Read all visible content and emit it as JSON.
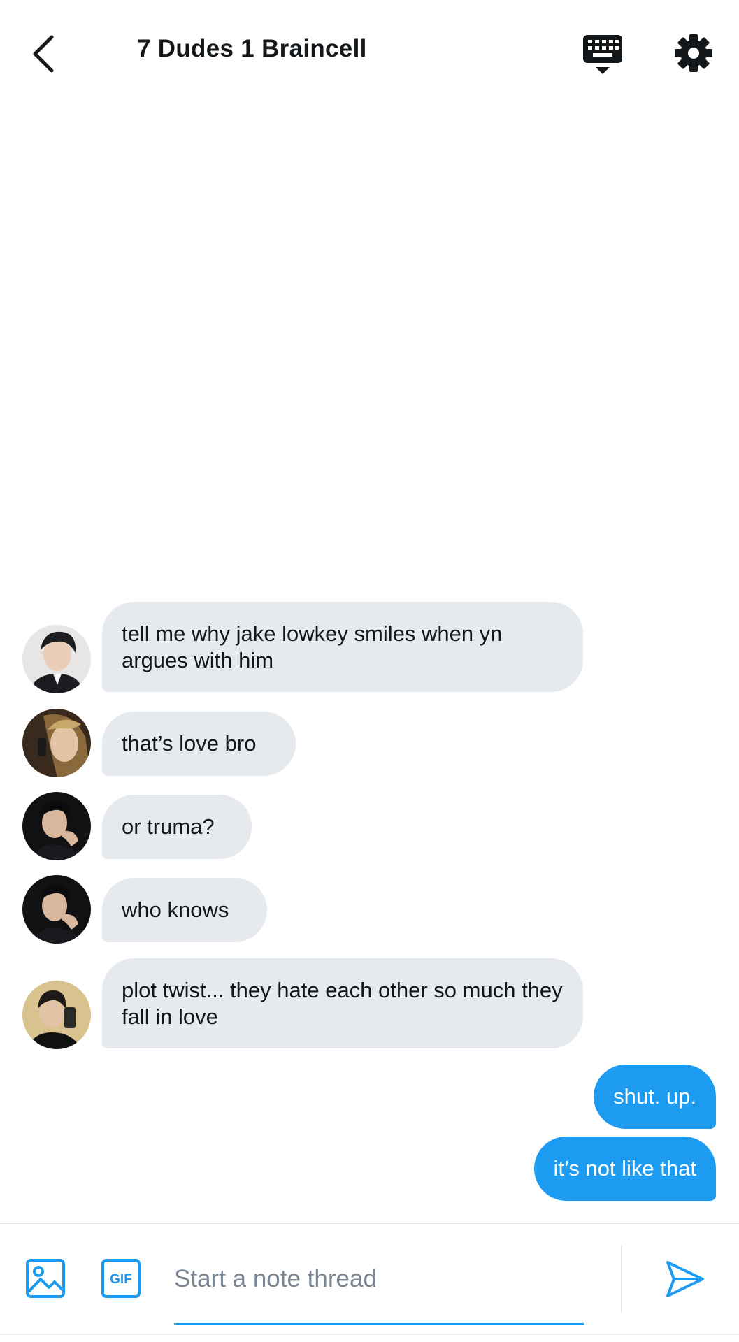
{
  "header": {
    "title": "7 Dudes 1 Braincell",
    "back_icon": "chevron-left-icon",
    "keyboard_icon": "keyboard-dismiss-icon",
    "settings_icon": "gear-icon"
  },
  "messages": [
    {
      "direction": "incoming",
      "text": "tell me why jake lowkey smiles when yn argues with him",
      "avatar": "avatar-1"
    },
    {
      "direction": "incoming",
      "text": "that’s love bro",
      "avatar": "avatar-2"
    },
    {
      "direction": "incoming",
      "text": "or truma?",
      "avatar": "avatar-3"
    },
    {
      "direction": "incoming",
      "text": "who knows",
      "avatar": "avatar-3"
    },
    {
      "direction": "incoming",
      "text": "plot twist... they hate each other so much they fall in love",
      "avatar": "avatar-4"
    },
    {
      "direction": "outgoing",
      "text": "shut. up."
    },
    {
      "direction": "outgoing",
      "text": "it’s not like that"
    }
  ],
  "composer": {
    "placeholder": "Start a note thread",
    "value": "",
    "gif_label": "GIF",
    "image_icon": "image-icon",
    "send_icon": "send-icon"
  },
  "colors": {
    "accent": "#1d9bf0",
    "incoming_bubble": "#e6eaee",
    "text": "#14171a",
    "placeholder": "#7b8794"
  }
}
